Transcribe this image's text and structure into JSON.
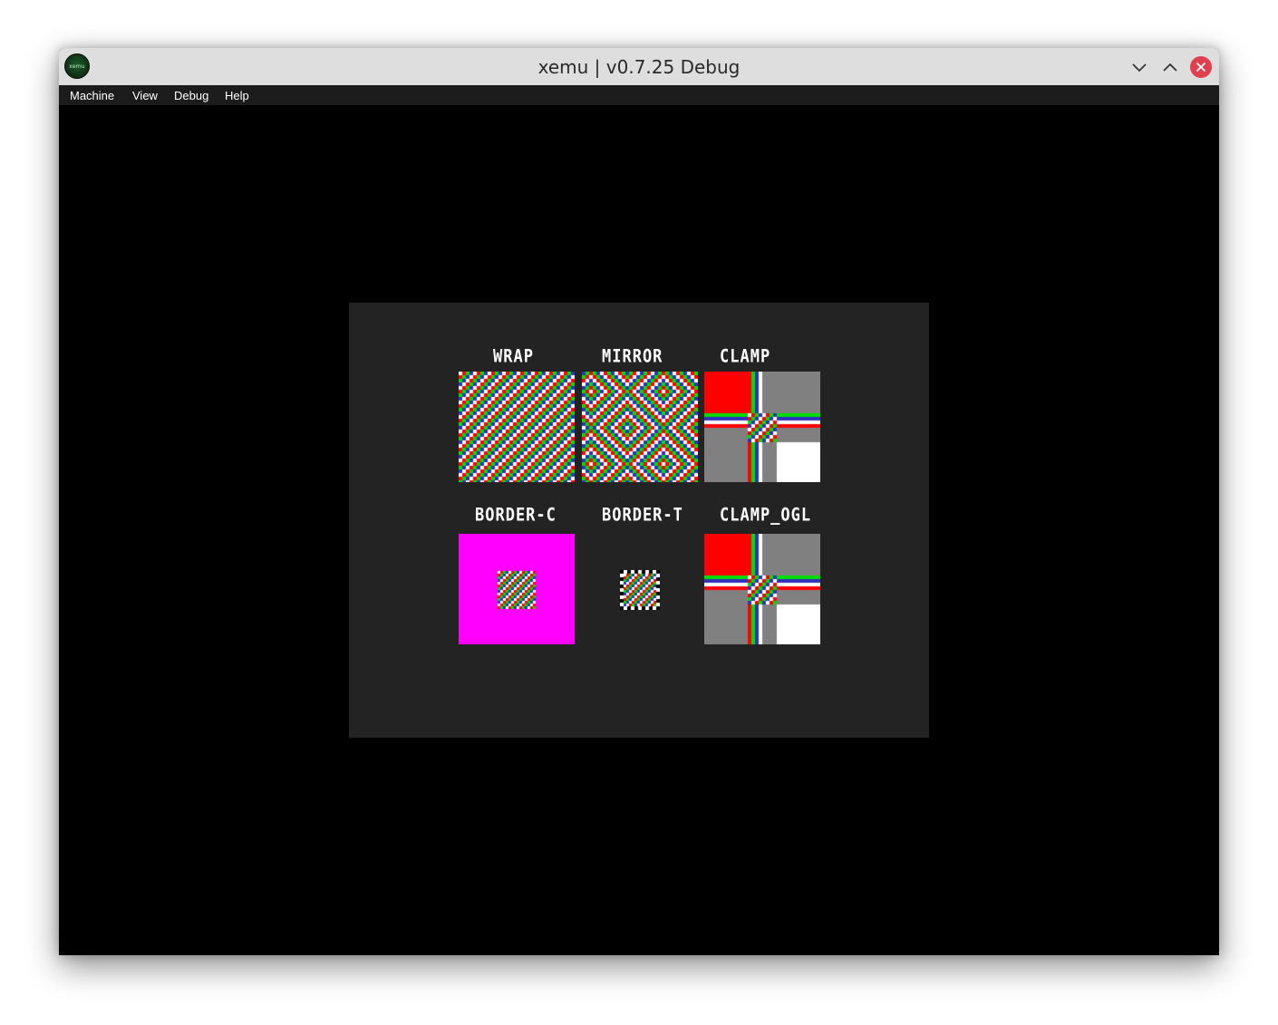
{
  "window": {
    "title": "xemu | v0.7.25 Debug",
    "icon_label": "xemu",
    "icons": [
      "app-logo-icon",
      "minimize-icon",
      "maximize-icon",
      "close-icon"
    ]
  },
  "menu": {
    "items": [
      "Machine",
      "View",
      "Debug",
      "Help"
    ]
  },
  "tests": {
    "labels": [
      "Wrap",
      "Mirror",
      "Clamp",
      "Border-C",
      "Border-T",
      "Clamp_OGL"
    ]
  },
  "colors": {
    "titlebar": "#dedede",
    "menubar": "#1c1c1c",
    "viewport": "#000000",
    "panel": "#232323",
    "red": "#ff0000",
    "green": "#00e000",
    "blue": "#3030c0",
    "white": "#ffffff",
    "gray": "#808080",
    "magenta": "#ff00ff",
    "close": "#e0404e"
  }
}
